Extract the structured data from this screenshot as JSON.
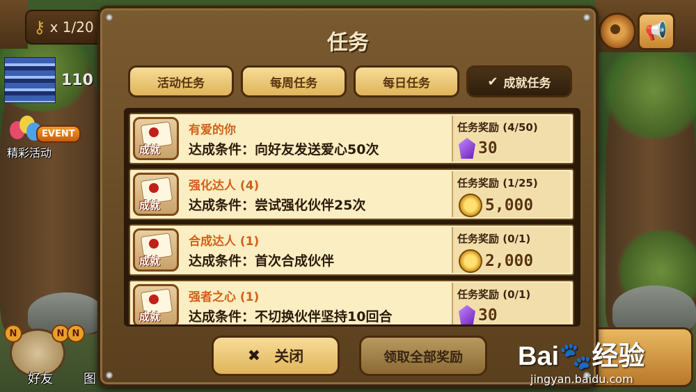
{
  "hud": {
    "keys": "x 1/20",
    "energy": "110",
    "event_tag": "EVENT",
    "event_label": "精彩活动",
    "friends_label": "好友",
    "other_label": "图",
    "badge_n": "N"
  },
  "dialog": {
    "title": "任务",
    "tabs": [
      {
        "label": "活动任务",
        "active": false
      },
      {
        "label": "每周任务",
        "active": false
      },
      {
        "label": "每日任务",
        "active": false
      },
      {
        "label": "成就任务",
        "active": true
      }
    ],
    "icon_tag": "成就",
    "quests": [
      {
        "name": "有爱的你",
        "condition": "达成条件：向好友发送爱心50次",
        "reward_label": "任务奖励 (4/50)",
        "reward_type": "gem",
        "reward_amount": "30"
      },
      {
        "name": "强化达人 (4)",
        "condition": "达成条件：尝试强化伙伴25次",
        "reward_label": "任务奖励 (1/25)",
        "reward_type": "coin",
        "reward_amount": "5,000"
      },
      {
        "name": "合成达人 (1)",
        "condition": "达成条件：首次合成伙伴",
        "reward_label": "任务奖励 (0/1)",
        "reward_type": "coin",
        "reward_amount": "2,000"
      },
      {
        "name": "强者之心 (1)",
        "condition": "达成条件：不切换伙伴坚持10回合",
        "reward_label": "任务奖励 (0/1)",
        "reward_type": "gem",
        "reward_amount": "30"
      }
    ],
    "close_label": "关闭",
    "claim_label": "领取全部奖励"
  },
  "watermark": {
    "brand_a": "Bai",
    "brand_b": "经验",
    "url": "jingyan.baidu.com"
  },
  "colors": {
    "quest_name": "#d2601a",
    "tab_active": "#2e1e0c",
    "tab_inactive": "#e0b45a"
  }
}
